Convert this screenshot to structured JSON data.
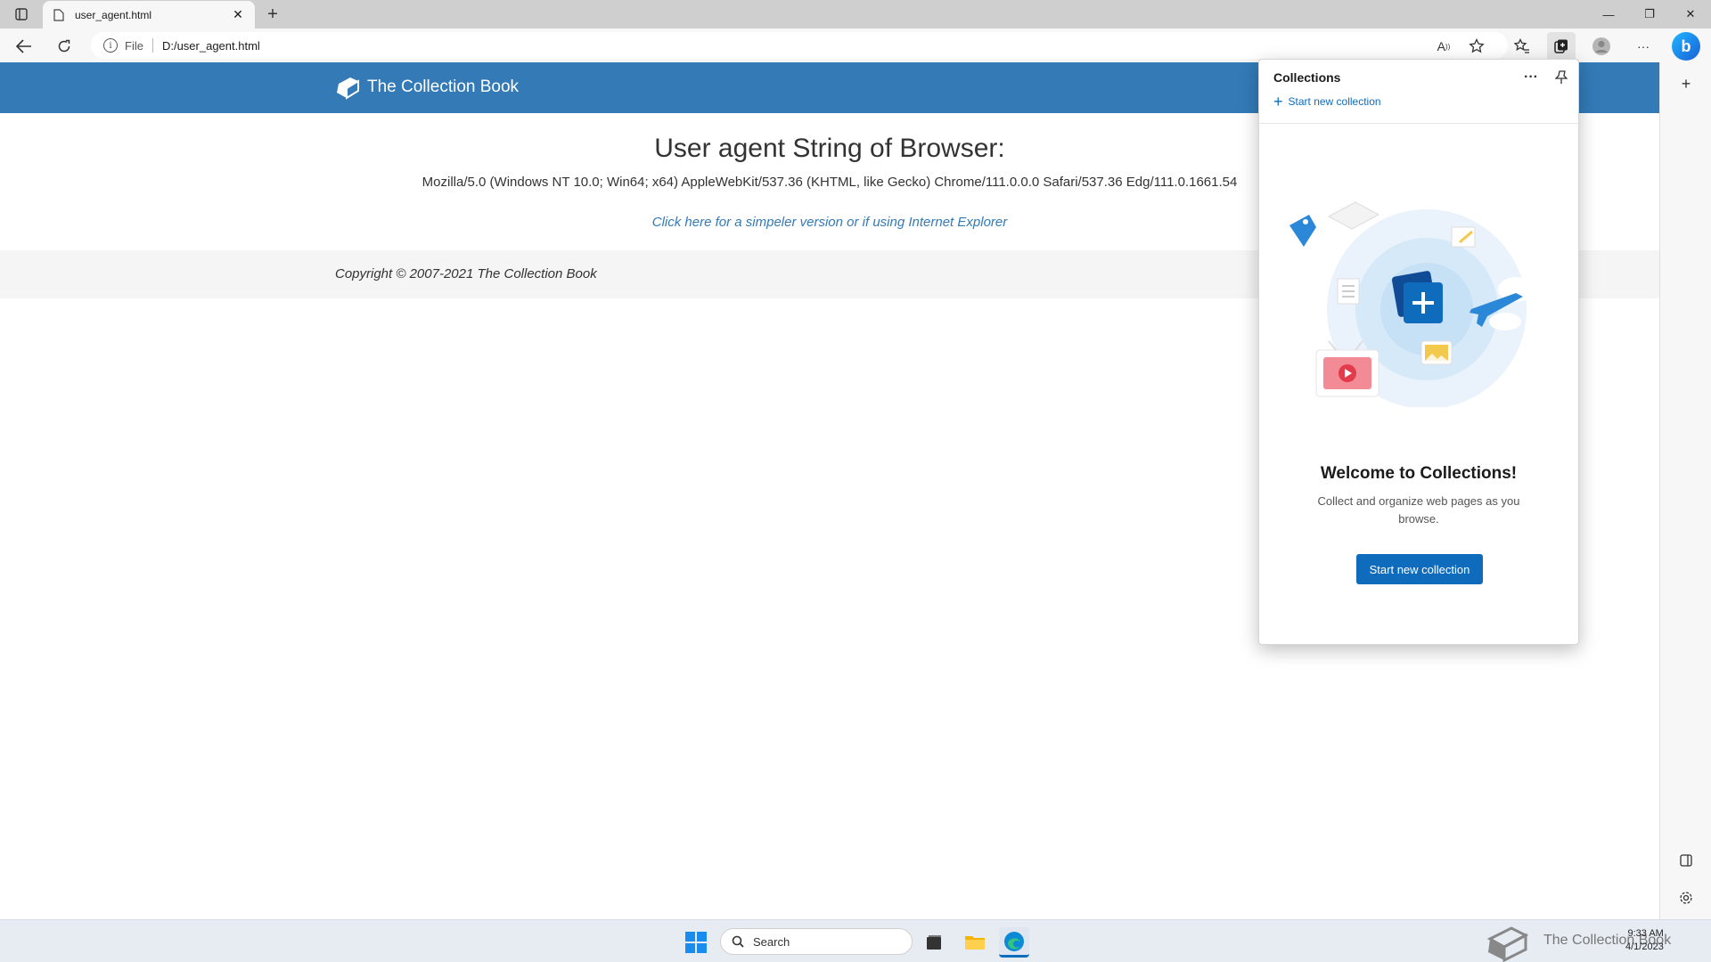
{
  "browser": {
    "tab_title": "user_agent.html",
    "new_tab": "+",
    "window_controls": {
      "minimize": "—",
      "restore": "❐",
      "close": "✕"
    },
    "address": {
      "scheme": "File",
      "url": "D:/user_agent.html"
    },
    "bing_label": "b",
    "sidebar_add": "+"
  },
  "page": {
    "brand": "The Collection Book",
    "heading": "User agent String of Browser:",
    "user_agent": "Mozilla/5.0 (Windows NT 10.0; Win64; x64) AppleWebKit/537.36 (KHTML, like Gecko) Chrome/111.0.0.0 Safari/537.36 Edg/111.0.1661.54",
    "simpler_link": "Click here for a simpeler version or if using Internet Explorer",
    "copyright": "Copyright © 2007-2021 The Collection Book",
    "header_color": "#337ab7"
  },
  "collections": {
    "title": "Collections",
    "more": "···",
    "start_link": "Start new collection",
    "welcome_title": "Welcome to Collections!",
    "welcome_desc": "Collect and organize web pages as you browse.",
    "button": "Start new collection",
    "accent": "#0f6cbd"
  },
  "taskbar": {
    "search_placeholder": "Search",
    "tray_text": "The Collection Book",
    "time": "9:33 AM",
    "date": "4/1/2023"
  }
}
